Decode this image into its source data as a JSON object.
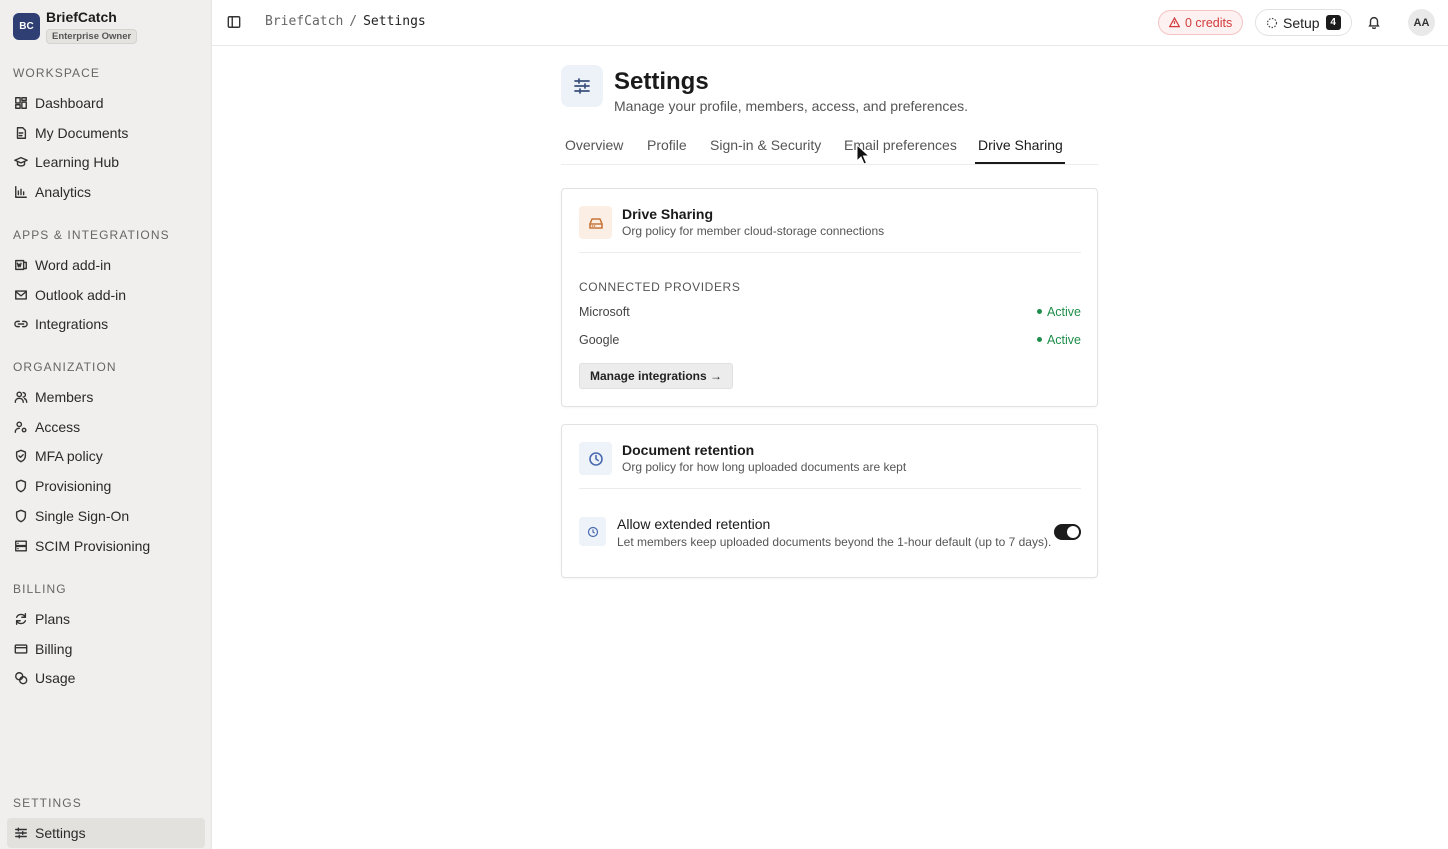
{
  "org": {
    "initials": "BC",
    "name": "BriefCatch",
    "role_badge": "Enterprise Owner"
  },
  "sidebar": {
    "workspace": {
      "heading": "WORKSPACE",
      "items": [
        {
          "label": "Dashboard",
          "icon": "dashboard-icon"
        },
        {
          "label": "My Documents",
          "icon": "documents-icon"
        },
        {
          "label": "Learning Hub",
          "icon": "graduation-cap-icon"
        },
        {
          "label": "Analytics",
          "icon": "bar-chart-icon"
        }
      ]
    },
    "apps": {
      "heading": "APPS & INTEGRATIONS",
      "items": [
        {
          "label": "Word add-in",
          "icon": "word-icon"
        },
        {
          "label": "Outlook add-in",
          "icon": "mail-icon"
        },
        {
          "label": "Integrations",
          "icon": "link-icon"
        }
      ]
    },
    "organization": {
      "heading": "ORGANIZATION",
      "items": [
        {
          "label": "Members",
          "icon": "users-icon"
        },
        {
          "label": "Access",
          "icon": "user-key-icon"
        },
        {
          "label": "MFA policy",
          "icon": "shield-check-icon"
        },
        {
          "label": "Provisioning",
          "icon": "shield-icon"
        },
        {
          "label": "Single Sign-On",
          "icon": "shield-icon"
        },
        {
          "label": "SCIM Provisioning",
          "icon": "server-icon"
        }
      ]
    },
    "billing": {
      "heading": "BILLING",
      "items": [
        {
          "label": "Plans",
          "icon": "refresh-icon"
        },
        {
          "label": "Billing",
          "icon": "credit-card-icon"
        },
        {
          "label": "Usage",
          "icon": "coins-icon"
        }
      ]
    },
    "settings": {
      "heading": "SETTINGS",
      "items": [
        {
          "label": "Settings",
          "icon": "sliders-icon"
        }
      ]
    }
  },
  "topbar": {
    "breadcrumb_root": "BriefCatch",
    "breadcrumb_sep": "/",
    "breadcrumb_current": "Settings",
    "credits_label": "0 credits",
    "setup_label": "Setup",
    "setup_count": "4",
    "avatar_initials": "AA"
  },
  "page": {
    "title": "Settings",
    "subtitle": "Manage your profile, members, access, and preferences.",
    "tabs": [
      {
        "label": "Overview"
      },
      {
        "label": "Profile"
      },
      {
        "label": "Sign-in & Security"
      },
      {
        "label": "Email preferences"
      },
      {
        "label": "Drive Sharing"
      }
    ],
    "active_tab": "Drive Sharing"
  },
  "drive_card": {
    "title": "Drive Sharing",
    "subtitle": "Org policy for member cloud-storage connections",
    "section_label": "CONNECTED PROVIDERS",
    "providers": [
      {
        "name": "Microsoft",
        "status": "Active"
      },
      {
        "name": "Google",
        "status": "Active"
      }
    ],
    "manage_button": "Manage integrations →"
  },
  "retention_card": {
    "title": "Document retention",
    "subtitle": "Org policy for how long uploaded documents are kept",
    "setting_title": "Allow extended retention",
    "setting_desc": "Let members keep uploaded documents beyond the 1-hour default (up to 7 days).",
    "toggle_on": true
  },
  "colors": {
    "sidebar_bg": "#f0efed",
    "credits_red": "#d23b3b",
    "active_green": "#1e8e4a",
    "drive_icon": "#c7773c",
    "retention_icon": "#4a6bb0"
  }
}
